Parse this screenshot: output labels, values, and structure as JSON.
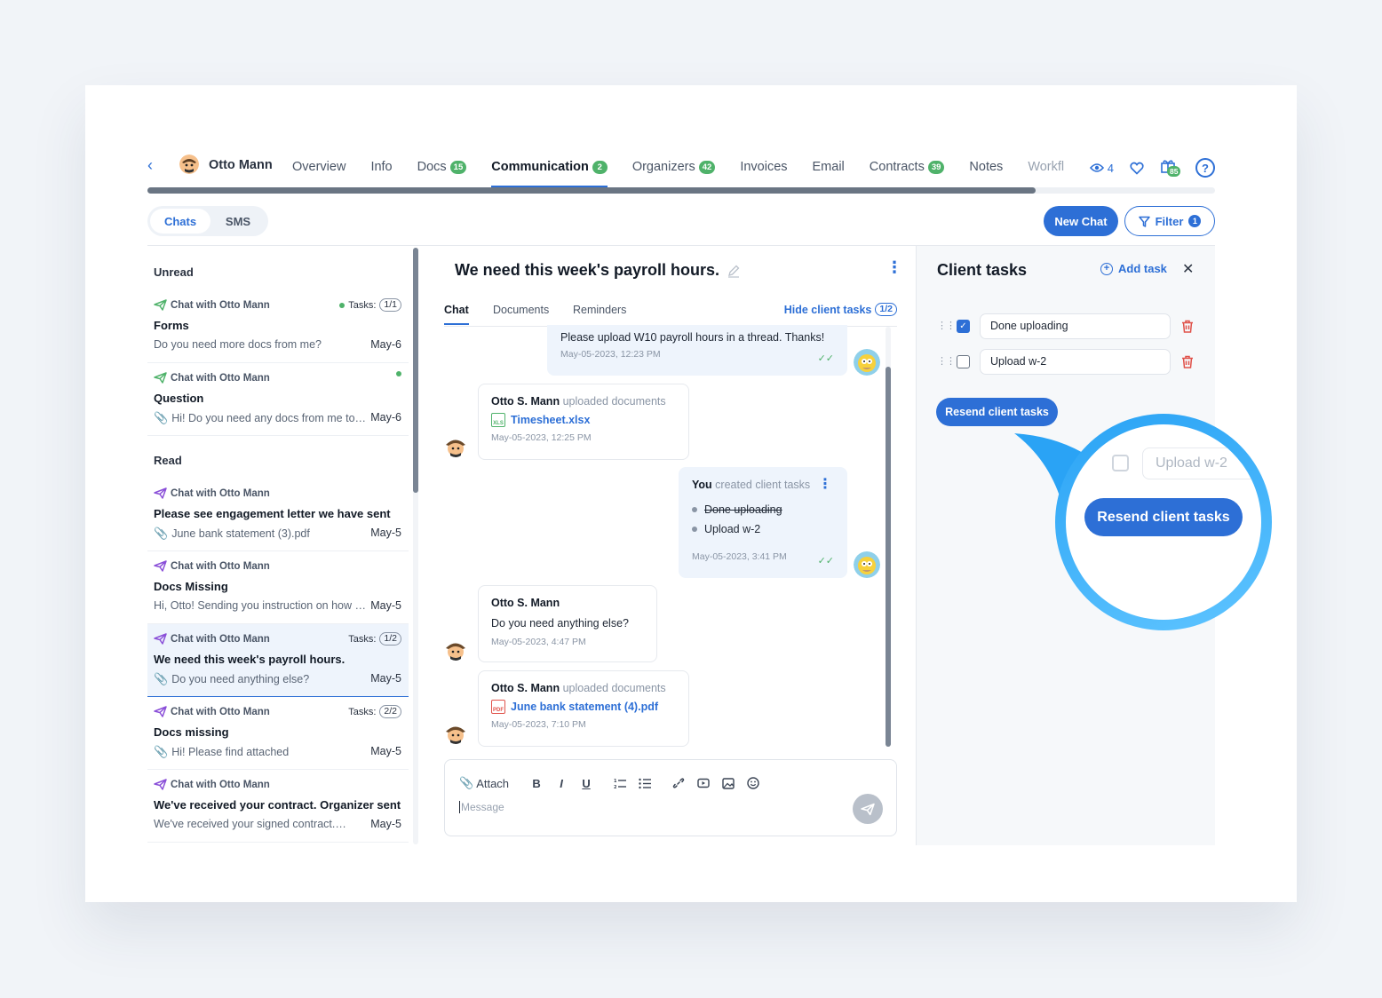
{
  "nav": {
    "client_name": "Otto Mann",
    "tabs": [
      {
        "label": "Overview"
      },
      {
        "label": "Info"
      },
      {
        "label": "Docs",
        "badge": "15"
      },
      {
        "label": "Communication",
        "badge": "2"
      },
      {
        "label": "Organizers",
        "badge": "42"
      },
      {
        "label": "Invoices"
      },
      {
        "label": "Email"
      },
      {
        "label": "Contracts",
        "badge": "39"
      },
      {
        "label": "Notes"
      },
      {
        "label": "Workfl"
      }
    ],
    "views_count": "4",
    "gift_count": "85",
    "help_label": "?"
  },
  "toolbar": {
    "segment_chats": "Chats",
    "segment_sms": "SMS",
    "new_chat": "New Chat",
    "filter_label": "Filter",
    "filter_count": "1"
  },
  "chatlist": {
    "unread_label": "Unread",
    "read_label": "Read",
    "items": [
      {
        "from": "Chat with Otto Mann",
        "tasks_label": "Tasks:",
        "tasks": "1/1",
        "title": "Forms",
        "preview": "Do you need more docs from me?",
        "date": "May-6"
      },
      {
        "from": "Chat with Otto Mann",
        "title": "Question",
        "preview": "Hi! Do you need any docs from me to prepare",
        "date": "May-6"
      },
      {
        "from": "Chat with Otto Mann",
        "title": "Please see engagement letter we have sent",
        "preview": "June bank statement (3).pdf",
        "date": "May-5"
      },
      {
        "from": "Chat with Otto Mann",
        "title": "Docs Missing",
        "preview": "Hi, Otto! Sending you instruction on how to upload",
        "date": "May-5"
      },
      {
        "from": "Chat with Otto Mann",
        "tasks_label": "Tasks:",
        "tasks": "1/2",
        "title": "We need this week's payroll hours.",
        "preview": "Do you need anything else?",
        "date": "May-5"
      },
      {
        "from": "Chat with Otto Mann",
        "tasks_label": "Tasks:",
        "tasks": "2/2",
        "title": "Docs missing",
        "preview": "Hi! Please find attached",
        "date": "May-5"
      },
      {
        "from": "Chat with Otto Mann",
        "title": "We've received your contract. Organizer sent",
        "preview": "We've received your signed contract.…",
        "date": "May-5"
      }
    ]
  },
  "chat": {
    "title": "We need this week's payroll hours.",
    "tabs": [
      "Chat",
      "Documents",
      "Reminders"
    ],
    "hide_tasks": "Hide client tasks",
    "hide_tasks_count": "1/2",
    "messages": [
      {
        "text": "Please upload W10 payroll hours in a thread. Thanks!",
        "ts": "May-05-2023, 12:23 PM"
      },
      {
        "who": "Otto S. Mann",
        "action": "uploaded documents",
        "file": "Timesheet.xlsx",
        "file_type": "XLS",
        "ts": "May-05-2023, 12:25 PM"
      },
      {
        "who": "You",
        "action": "created client tasks",
        "items": [
          "Done uploading",
          "Upload w-2"
        ],
        "ts": "May-05-2023, 3:41 PM"
      },
      {
        "who": "Otto S. Mann",
        "text": "Do you need anything else?",
        "ts": "May-05-2023, 4:47 PM"
      },
      {
        "who": "Otto S. Mann",
        "action": "uploaded documents",
        "file": "June bank statement (4).pdf",
        "file_type": "PDF",
        "ts": "May-05-2023, 7:10 PM"
      }
    ],
    "composer": {
      "attach": "Attach",
      "bold": "B",
      "italic": "I",
      "underline": "U",
      "placeholder": "Message"
    }
  },
  "tasks_panel": {
    "title": "Client tasks",
    "add_task": "Add task",
    "tasks": [
      {
        "label": "Done uploading",
        "done": true
      },
      {
        "label": "Upload w-2",
        "done": false
      }
    ],
    "resend": "Resend client tasks"
  },
  "magnifier": {
    "field": "Upload w-2",
    "button": "Resend client tasks"
  },
  "colors": {
    "accent": "#2d6fd6",
    "success": "#4fb26a",
    "danger": "#e0524a",
    "magnifier": "#2aa3f5"
  }
}
